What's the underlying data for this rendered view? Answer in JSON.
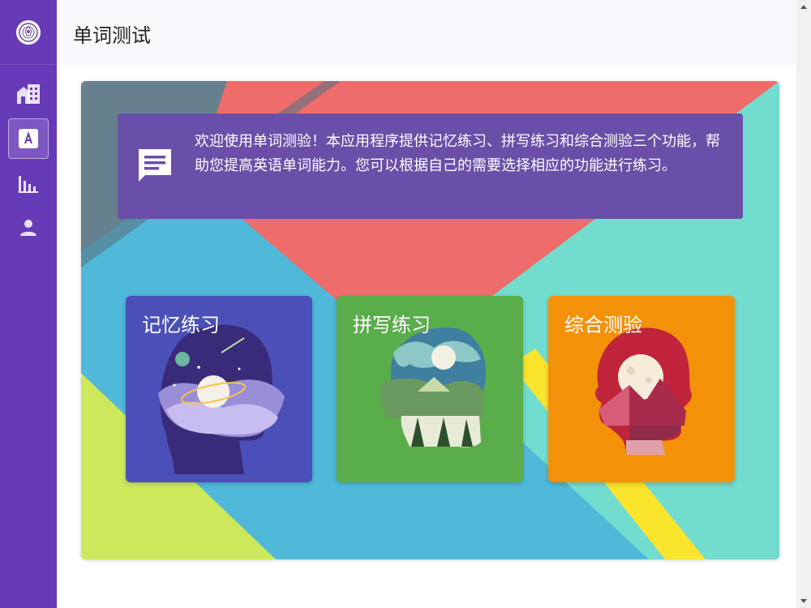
{
  "app": {
    "page_title": "单词测试"
  },
  "sidebar": {
    "logo": "logo-icon",
    "items": [
      {
        "name": "home",
        "icon": "building-icon",
        "active": false
      },
      {
        "name": "word-test",
        "icon": "letter-a-icon",
        "active": true
      },
      {
        "name": "statistics",
        "icon": "bar-chart-icon",
        "active": false
      },
      {
        "name": "profile",
        "icon": "person-icon",
        "active": false
      }
    ]
  },
  "notice": {
    "icon": "message-icon",
    "text": "欢迎使用单词测验！本应用程序提供记忆练习、拼写练习和综合测验三个功能，帮助您提高英语单词能力。您可以根据自己的需要选择相应的功能进行练习。"
  },
  "tiles": [
    {
      "title": "记忆练习",
      "color": "#4b50b8"
    },
    {
      "title": "拼写练习",
      "color": "#5aad4b"
    },
    {
      "title": "综合测验",
      "color": "#f39208"
    }
  ],
  "colors": {
    "sidebar": "#673ab7",
    "notice": "#6a4fa8"
  }
}
